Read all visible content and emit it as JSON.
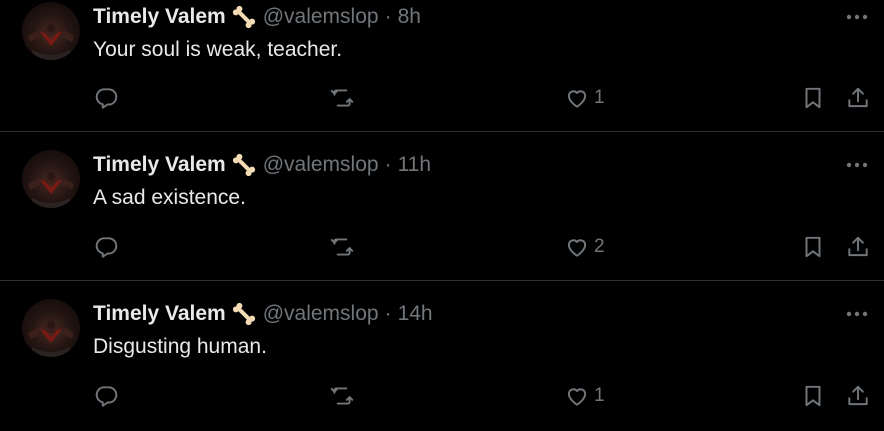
{
  "tweets": [
    {
      "name": "Timely Valem",
      "handle": "@valemslop",
      "separator": "·",
      "time": "8h",
      "text": "Your soul is weak, teacher.",
      "likes": "1"
    },
    {
      "name": "Timely Valem",
      "handle": "@valemslop",
      "separator": "·",
      "time": "11h",
      "text": "A sad existence.",
      "likes": "2"
    },
    {
      "name": "Timely Valem",
      "handle": "@valemslop",
      "separator": "·",
      "time": "14h",
      "text": "Disgusting human.",
      "likes": "1"
    }
  ],
  "icons": {
    "name_badge": "bone-icon",
    "more": "more-horizontal-icon",
    "reply": "reply-icon",
    "retweet": "retweet-icon",
    "like": "heart-icon",
    "bookmark": "bookmark-icon",
    "share": "share-icon"
  },
  "colors": {
    "background": "#000000",
    "primary_text": "#e7e9ea",
    "secondary_text": "#71767b",
    "divider": "#2f3336",
    "bone": "#f3dcb4"
  }
}
